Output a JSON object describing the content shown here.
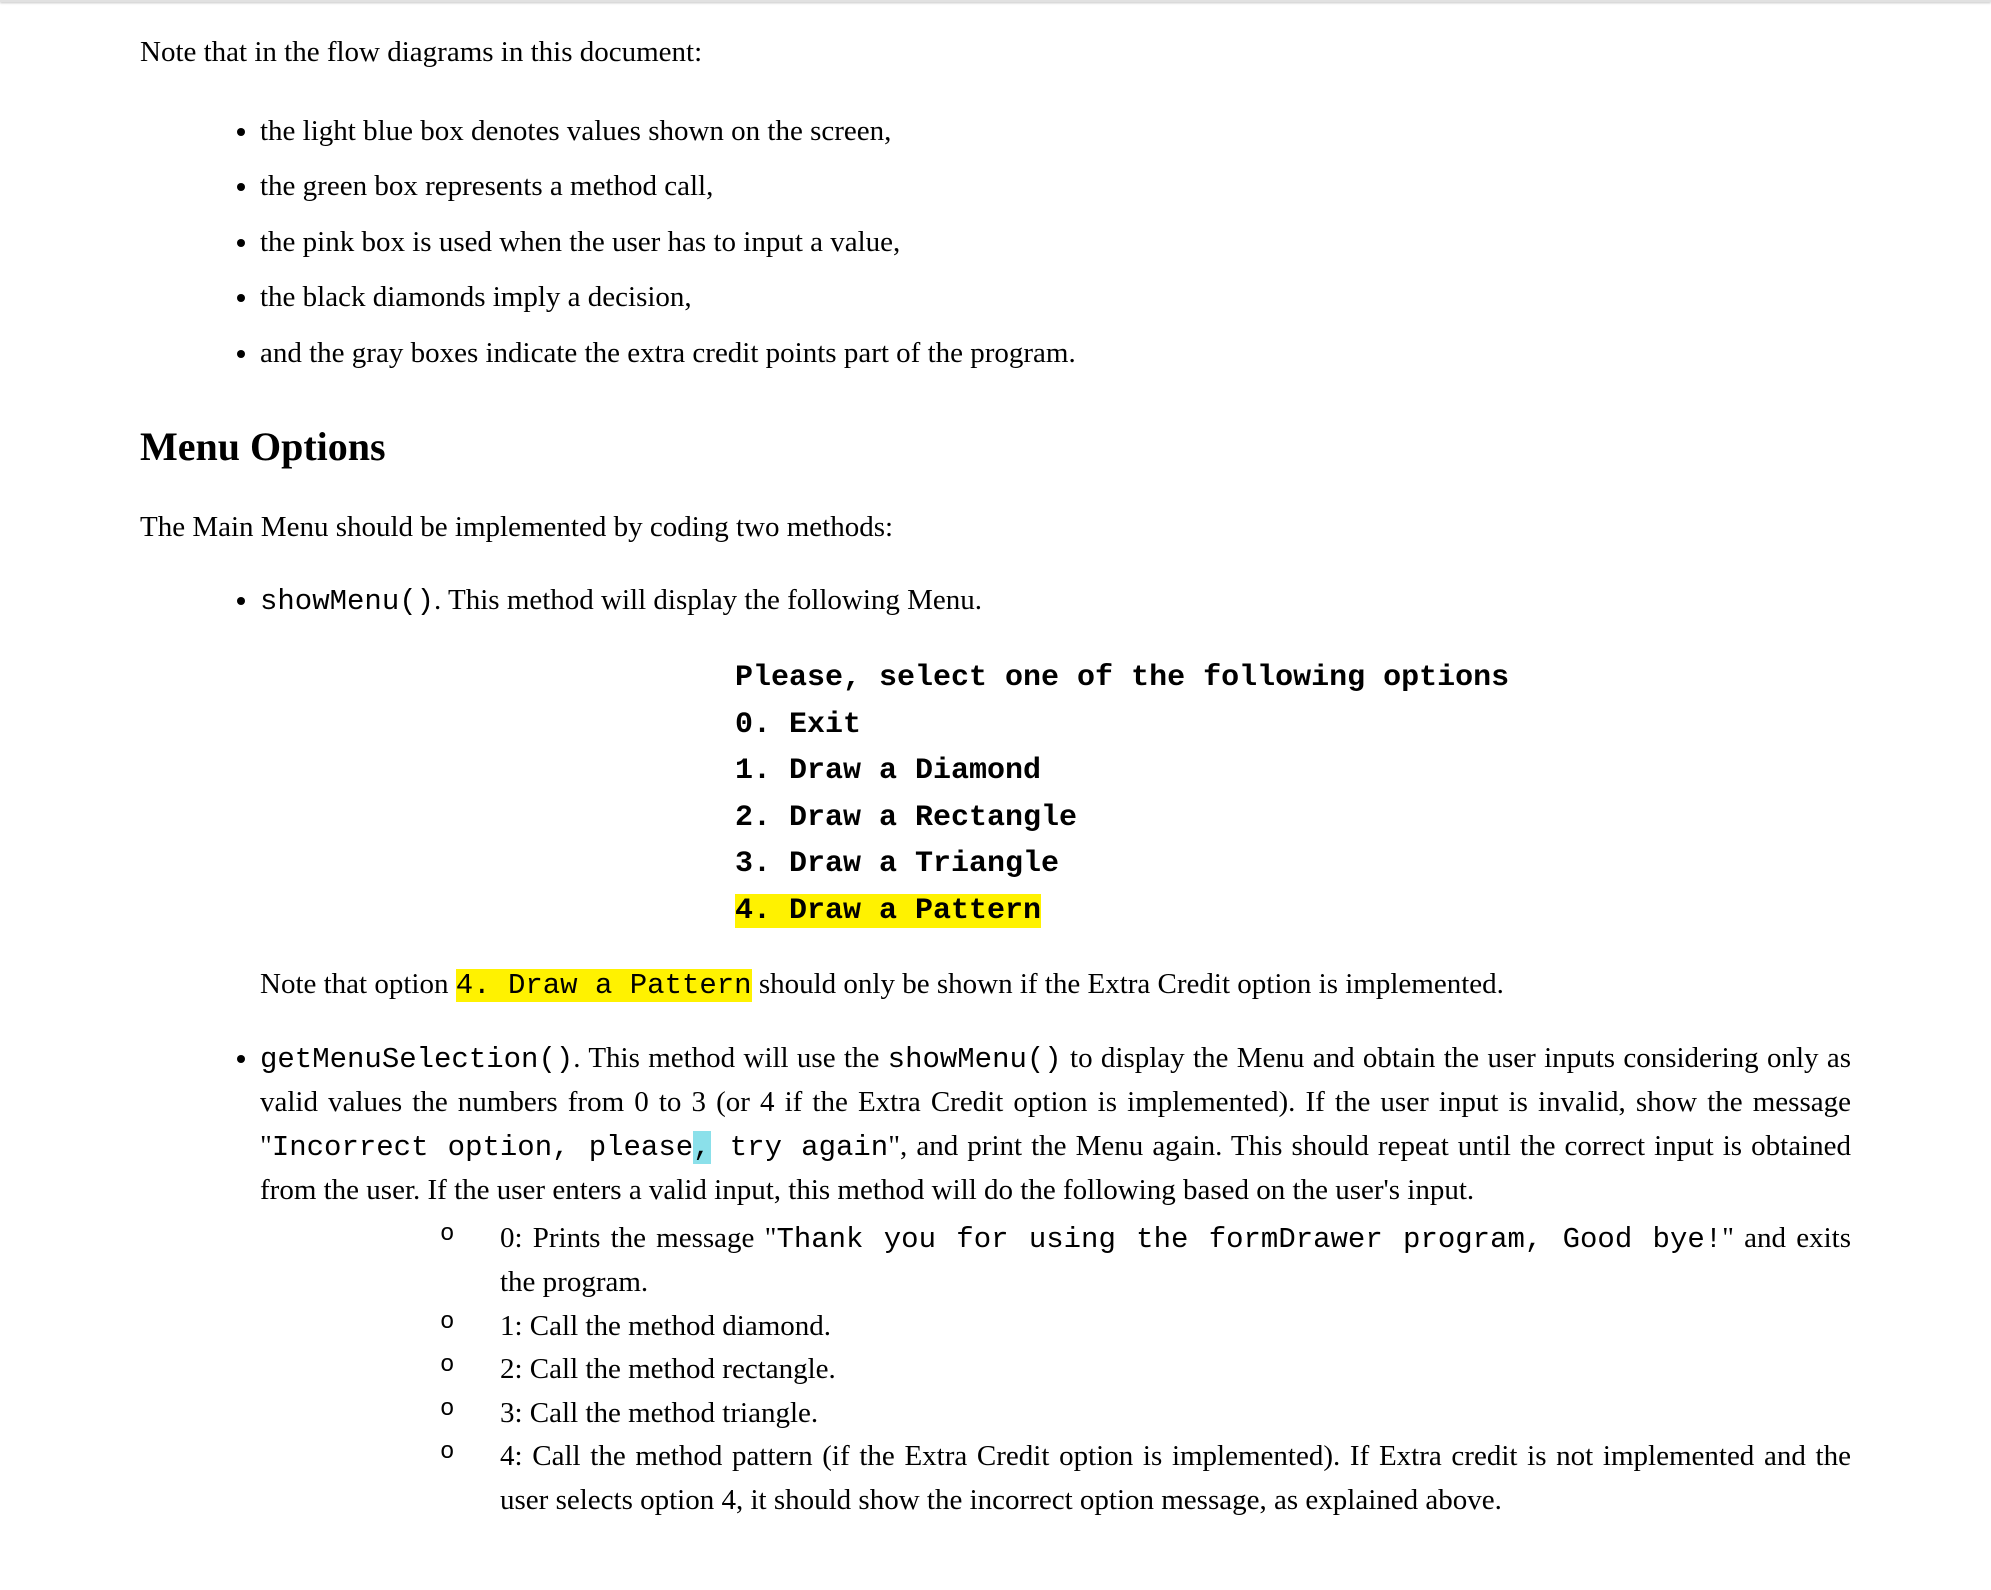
{
  "intro": "Note that in the flow diagrams in this document:",
  "legend": [
    "the light blue box denotes values shown on the screen,",
    "the green box represents a method call,",
    "the pink box is used when the user has to input a value,",
    "the black diamonds imply a decision,",
    "and the gray boxes indicate the extra credit points part of the program."
  ],
  "section_heading": "Menu Options",
  "methods_intro": "The Main Menu should be implemented by coding two methods:",
  "showMenu": {
    "name": "showMenu()",
    "suffix": ". This method will display the following Menu.",
    "menu_lines": [
      "Please, select one of the following options",
      "0. Exit",
      "1. Draw a Diamond",
      "2. Draw a Rectangle",
      "3. Draw a Triangle"
    ],
    "menu_hl_line": "4. Draw a Pattern",
    "note_prefix": "Note that option ",
    "note_hl": "4. Draw a Pattern",
    "note_suffix": " should only be shown if the Extra Credit option is implemented."
  },
  "getMenuSelection": {
    "name": "getMenuSelection()",
    "t1": ". This method will use the ",
    "sm": "showMenu()",
    "t2": " to display the Menu and obtain the user inputs considering only as valid values the numbers from 0 to 3 (or 4 if the Extra Credit option is implemented). If the user input is invalid, show the message \"",
    "err_a": "Incorrect option, please",
    "err_comma": ",",
    "err_b": " try again",
    "t3": "\", and print the Menu again. This should repeat until the correct input is obtained from the user. If the user enters a valid input, this method will do the following based on the user's input.",
    "opt0_a": "0: Prints the message \"",
    "opt0_code": "Thank you for using the formDrawer program, Good bye!",
    "opt0_b": "\" and exits the program.",
    "opt1": "1: Call the method diamond.",
    "opt2": "2: Call the method rectangle.",
    "opt3": "3: Call the method triangle.",
    "opt4": "4: Call the method pattern (if the Extra Credit option is implemented). If Extra credit is not implemented and the user selects option 4, it should show the incorrect option message, as explained above."
  }
}
